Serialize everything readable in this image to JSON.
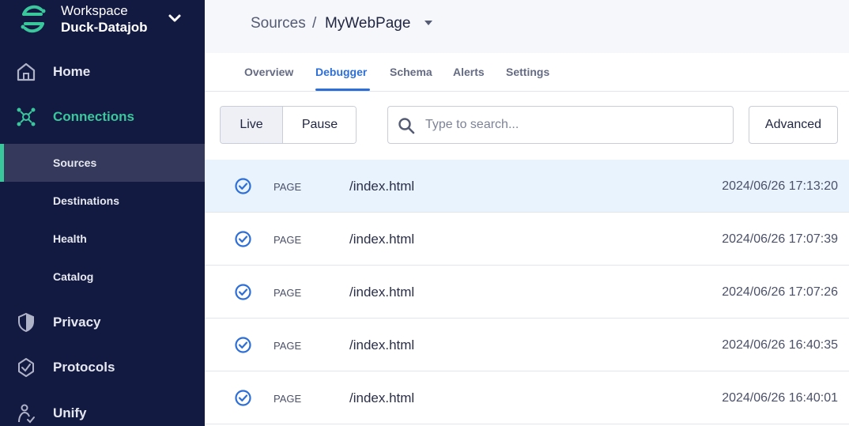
{
  "workspace": {
    "label": "Workspace",
    "name": "Duck-Datajob"
  },
  "sidebar": {
    "items": [
      {
        "label": "Home"
      },
      {
        "label": "Connections"
      },
      {
        "label": "Privacy"
      },
      {
        "label": "Protocols"
      },
      {
        "label": "Unify"
      }
    ],
    "subitems": [
      {
        "label": "Sources"
      },
      {
        "label": "Destinations"
      },
      {
        "label": "Health"
      },
      {
        "label": "Catalog"
      }
    ]
  },
  "breadcrumb": {
    "parent": "Sources",
    "separator": "/",
    "current": "MyWebPage"
  },
  "tabs": [
    {
      "label": "Overview"
    },
    {
      "label": "Debugger"
    },
    {
      "label": "Schema"
    },
    {
      "label": "Alerts"
    },
    {
      "label": "Settings"
    }
  ],
  "toolbar": {
    "live_label": "Live",
    "pause_label": "Pause",
    "search_placeholder": "Type to search...",
    "advanced_label": "Advanced"
  },
  "events": [
    {
      "type": "PAGE",
      "path": "/index.html",
      "timestamp": "2024/06/26 17:13:20"
    },
    {
      "type": "PAGE",
      "path": "/index.html",
      "timestamp": "2024/06/26 17:07:39"
    },
    {
      "type": "PAGE",
      "path": "/index.html",
      "timestamp": "2024/06/26 17:07:26"
    },
    {
      "type": "PAGE",
      "path": "/index.html",
      "timestamp": "2024/06/26 16:40:35"
    },
    {
      "type": "PAGE",
      "path": "/index.html",
      "timestamp": "2024/06/26 16:40:01"
    }
  ],
  "colors": {
    "sidebar_bg": "#131a42",
    "accent_green": "#39c79b",
    "accent_blue": "#2d6fd6",
    "highlight_row": "#e8f3fe"
  }
}
